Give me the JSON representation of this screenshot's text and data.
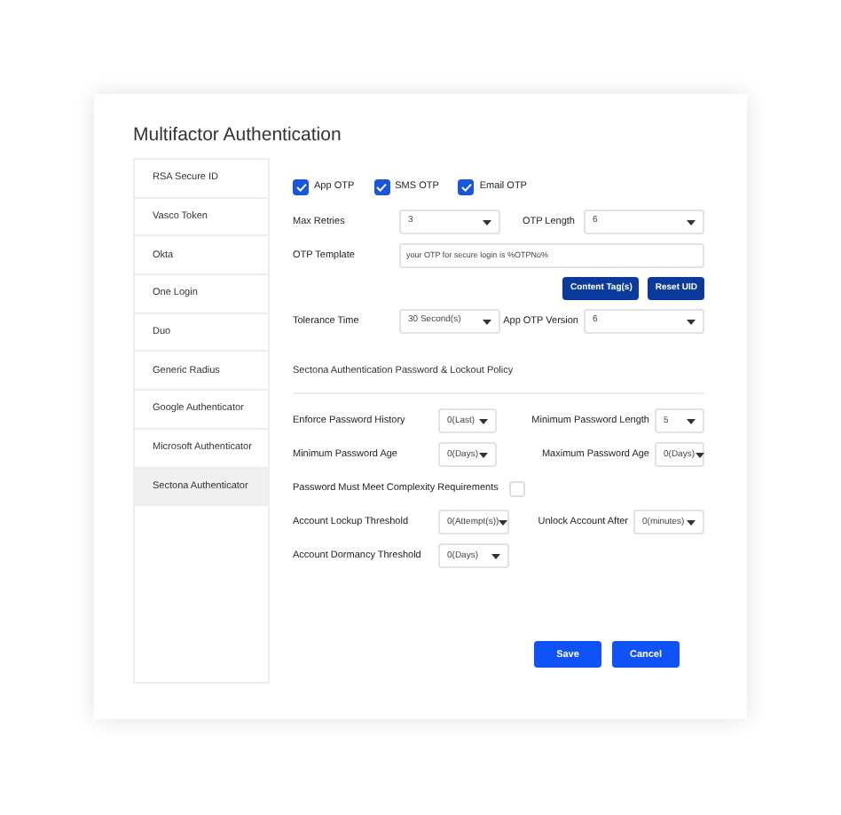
{
  "title": "Multifactor Authentication",
  "sidebar": {
    "items": [
      {
        "label": "RSA Secure ID",
        "selected": false
      },
      {
        "label": "Vasco Token",
        "selected": false
      },
      {
        "label": "Okta",
        "selected": false
      },
      {
        "label": "One Login",
        "selected": false
      },
      {
        "label": "Duo",
        "selected": false
      },
      {
        "label": "Generic Radius",
        "selected": false
      },
      {
        "label": "Google Authenticator",
        "selected": false
      },
      {
        "label": "Microsoft Authenticator",
        "selected": false
      },
      {
        "label": "Sectona Authenticator",
        "selected": true
      }
    ]
  },
  "otp_types": [
    {
      "label": "App OTP",
      "checked": true
    },
    {
      "label": "SMS OTP",
      "checked": true
    },
    {
      "label": "Email OTP",
      "checked": true
    }
  ],
  "max_retries": {
    "label": "Max Retries",
    "value": "3"
  },
  "otp_length": {
    "label": "OTP Length",
    "value": "6"
  },
  "otp_template": {
    "label": "OTP Template",
    "value": "your OTP for secure login is %OTPNo%"
  },
  "template_buttons": [
    "Content Tag(s)",
    "Reset UID"
  ],
  "tolerance_time": {
    "label": "Tolerance Time",
    "value": "30 Second(s)"
  },
  "app_otp_version": {
    "label": "App OTP Version",
    "value": "6"
  },
  "policy": {
    "heading": "Sectona Authentication Password & Lockout Policy",
    "rows": [
      [
        {
          "label": "Enforce Password History",
          "value": "0(Last)"
        },
        {
          "label": "Minimum Password Length",
          "value": "5"
        }
      ],
      [
        {
          "label": "Minimum Password Age",
          "value": "0(Days)"
        },
        {
          "label": "Maximum Password Age",
          "value": "0(Days)"
        }
      ]
    ],
    "complexity": {
      "label": "Password Must Meet Complexity Requirements",
      "checked": false
    },
    "rows2": [
      [
        {
          "label": "Account Lockup Threshold",
          "value": "0(Attempt(s))"
        },
        {
          "label": "Unlock Account After",
          "value": "0(minutes)"
        }
      ],
      [
        {
          "label": "Account Dormancy Threshold",
          "value": "0(Days)"
        }
      ]
    ]
  },
  "buttons": [
    "Save",
    "Cancel"
  ]
}
